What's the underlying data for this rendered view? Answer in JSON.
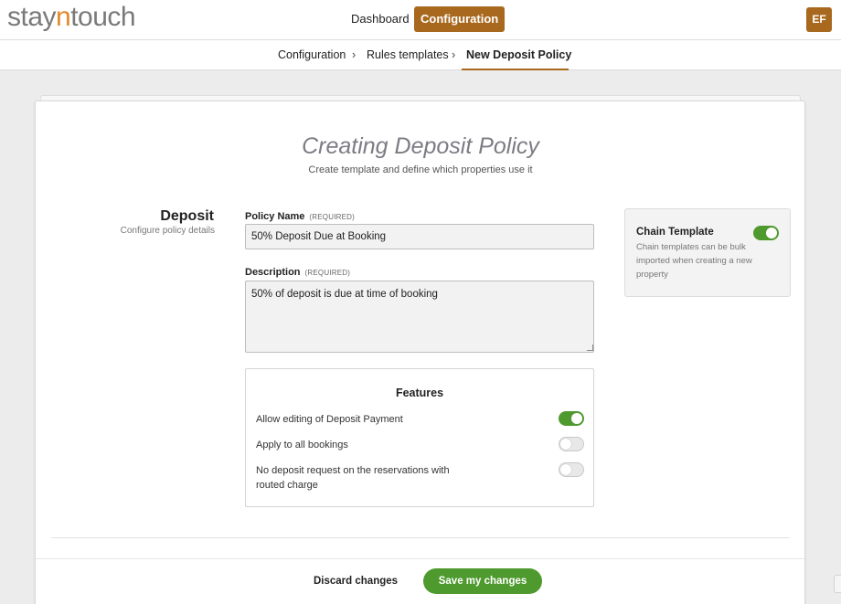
{
  "app": {
    "logo_left": "stay",
    "logo_accent": "n",
    "logo_right": "touch",
    "brand_color": "#a8691f",
    "accent_green": "#4f9a2e"
  },
  "nav": {
    "dashboard": "Dashboard",
    "configuration": "Configuration",
    "active": "Configuration"
  },
  "user": {
    "initials": "EF"
  },
  "breadcrumb": {
    "items": [
      "Configuration",
      "Rules templates",
      "New Deposit Policy"
    ],
    "separator": "›"
  },
  "page": {
    "title": "Creating Deposit Policy",
    "subtitle": "Create template and define which properties use it"
  },
  "section": {
    "title": "Deposit",
    "subtitle": "Configure policy details"
  },
  "form": {
    "policy_name": {
      "label": "Policy Name",
      "required_tag": "(REQUIRED)",
      "value": "50% Deposit Due at Booking"
    },
    "description": {
      "label": "Description",
      "required_tag": "(REQUIRED)",
      "value": "50% of deposit is due at time of booking"
    }
  },
  "features": {
    "title": "Features",
    "items": [
      {
        "label": "Allow editing of Deposit Payment",
        "enabled": true
      },
      {
        "label": "Apply to all bookings",
        "enabled": false
      },
      {
        "label": "No deposit request on the reservations with routed charge",
        "enabled": false
      }
    ]
  },
  "chain_template": {
    "title": "Chain Template",
    "description": "Chain templates can be bulk imported when creating a new property",
    "enabled": true
  },
  "footer": {
    "discard": "Discard changes",
    "save": "Save my changes"
  },
  "icons": {
    "resize_grip": "resize-grip-icon",
    "crumb_separator": "chevron-right-icon"
  }
}
